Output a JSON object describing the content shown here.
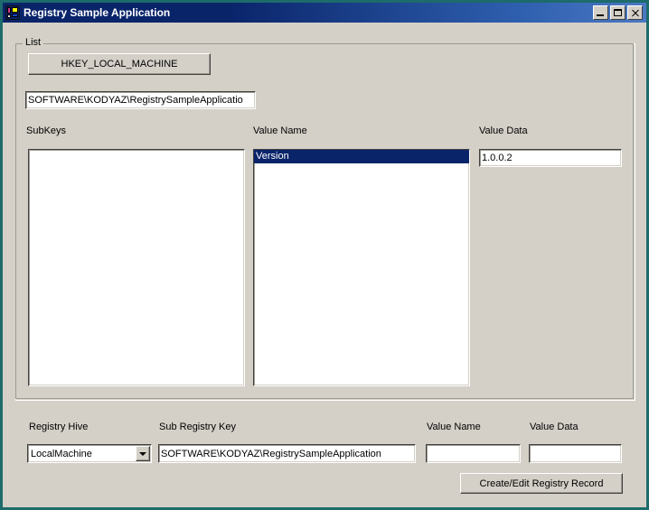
{
  "window": {
    "title": "Registry Sample Application",
    "icon": "application-icon",
    "controls": {
      "minimize": "Minimize",
      "maximize": "Maximize",
      "close": "Close"
    }
  },
  "groupbox": {
    "title": "List"
  },
  "top": {
    "hive_button_label": "HKEY_LOCAL_MACHINE",
    "path_value": "SOFTWARE\\KODYAZ\\RegistrySampleApplicatio",
    "labels": {
      "subkeys": "SubKeys",
      "value_name": "Value Name",
      "value_data": "Value Data"
    },
    "subkeys_items": [],
    "value_name_items": [
      {
        "label": "Version",
        "selected": true
      }
    ],
    "value_data_value": "1.0.0.2"
  },
  "bottom": {
    "labels": {
      "registry_hive": "Registry Hive",
      "sub_registry_key": "Sub Registry Key",
      "value_name": "Value Name",
      "value_data": "Value Data"
    },
    "registry_hive_selected": "LocalMachine",
    "sub_registry_key_value": "SOFTWARE\\KODYAZ\\RegistrySampleApplication",
    "value_name_value": "",
    "value_data_value": "",
    "value_name_placeholder": "",
    "value_data_placeholder": "",
    "create_button_label": "Create/Edit Registry Record"
  },
  "colors": {
    "window_border": "#1d6b6b",
    "titlebar_start": "#0a246a",
    "titlebar_end": "#4a79c4",
    "face": "#d4d0c8",
    "selection": "#0a246a",
    "text": "#000000"
  }
}
